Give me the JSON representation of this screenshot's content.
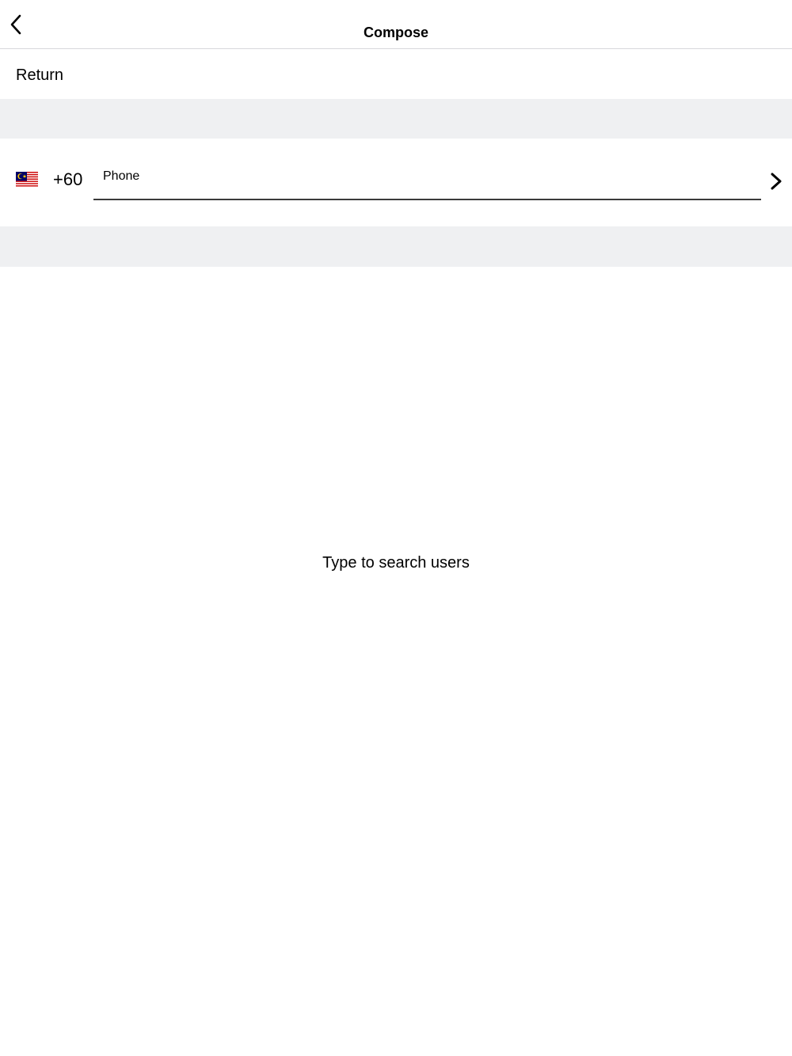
{
  "navbar": {
    "title": "Compose",
    "back_icon": "chevron-left-icon"
  },
  "return_row": {
    "label": "Return"
  },
  "phone_row": {
    "flag_icon": "malaysia-flag-icon",
    "dial_code": "+60",
    "phone_placeholder": "Phone",
    "phone_value": "",
    "next_icon": "chevron-right-icon"
  },
  "search": {
    "empty_message": "Type to search users"
  },
  "colors": {
    "background": "#ffffff",
    "section_spacer": "#eff0f2",
    "divider": "#d8d8dc",
    "input_underline": "#3a3a3a",
    "text": "#000000"
  }
}
